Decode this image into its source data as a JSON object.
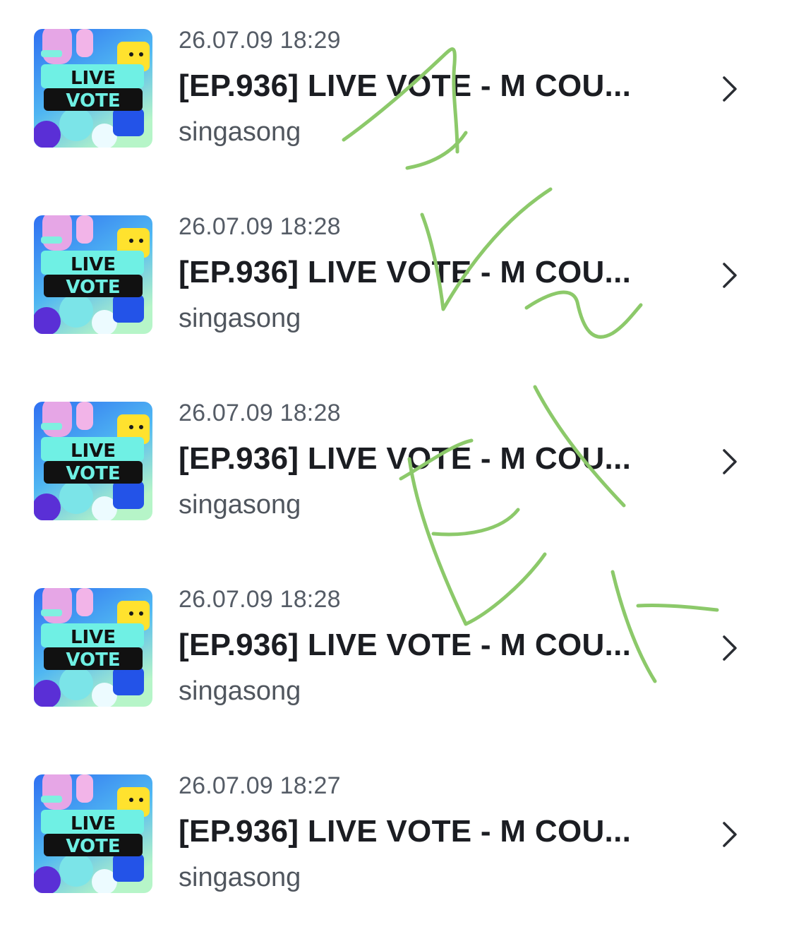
{
  "items": [
    {
      "date": "26.07.09 18:29",
      "title": "[EP.936] LIVE VOTE - M COU...",
      "author": "singasong",
      "thumb_line1": "LIVE",
      "thumb_line2": "VOTE"
    },
    {
      "date": "26.07.09 18:28",
      "title": "[EP.936] LIVE VOTE - M COU...",
      "author": "singasong",
      "thumb_line1": "LIVE",
      "thumb_line2": "VOTE"
    },
    {
      "date": "26.07.09 18:28",
      "title": "[EP.936] LIVE VOTE - M COU...",
      "author": "singasong",
      "thumb_line1": "LIVE",
      "thumb_line2": "VOTE"
    },
    {
      "date": "26.07.09 18:28",
      "title": "[EP.936] LIVE VOTE - M COU...",
      "author": "singasong",
      "thumb_line1": "LIVE",
      "thumb_line2": "VOTE"
    },
    {
      "date": "26.07.09 18:27",
      "title": "[EP.936] LIVE VOTE - M COU...",
      "author": "singasong",
      "thumb_line1": "LIVE",
      "thumb_line2": "VOTE"
    }
  ],
  "icons": {
    "row_action": "chevron-right-icon"
  },
  "colors": {
    "background": "#ffffff",
    "title_text": "#1b1d22",
    "meta_text": "#555c66",
    "chevron": "#2a2d33",
    "annotation_ink": "#8cc96a",
    "thumb_bg_top": "#2f7bf5",
    "thumb_bg_bottom": "#8ee8e0",
    "thumb_label_bg": "#6ff0e4",
    "thumb_label_band": "#111111"
  }
}
